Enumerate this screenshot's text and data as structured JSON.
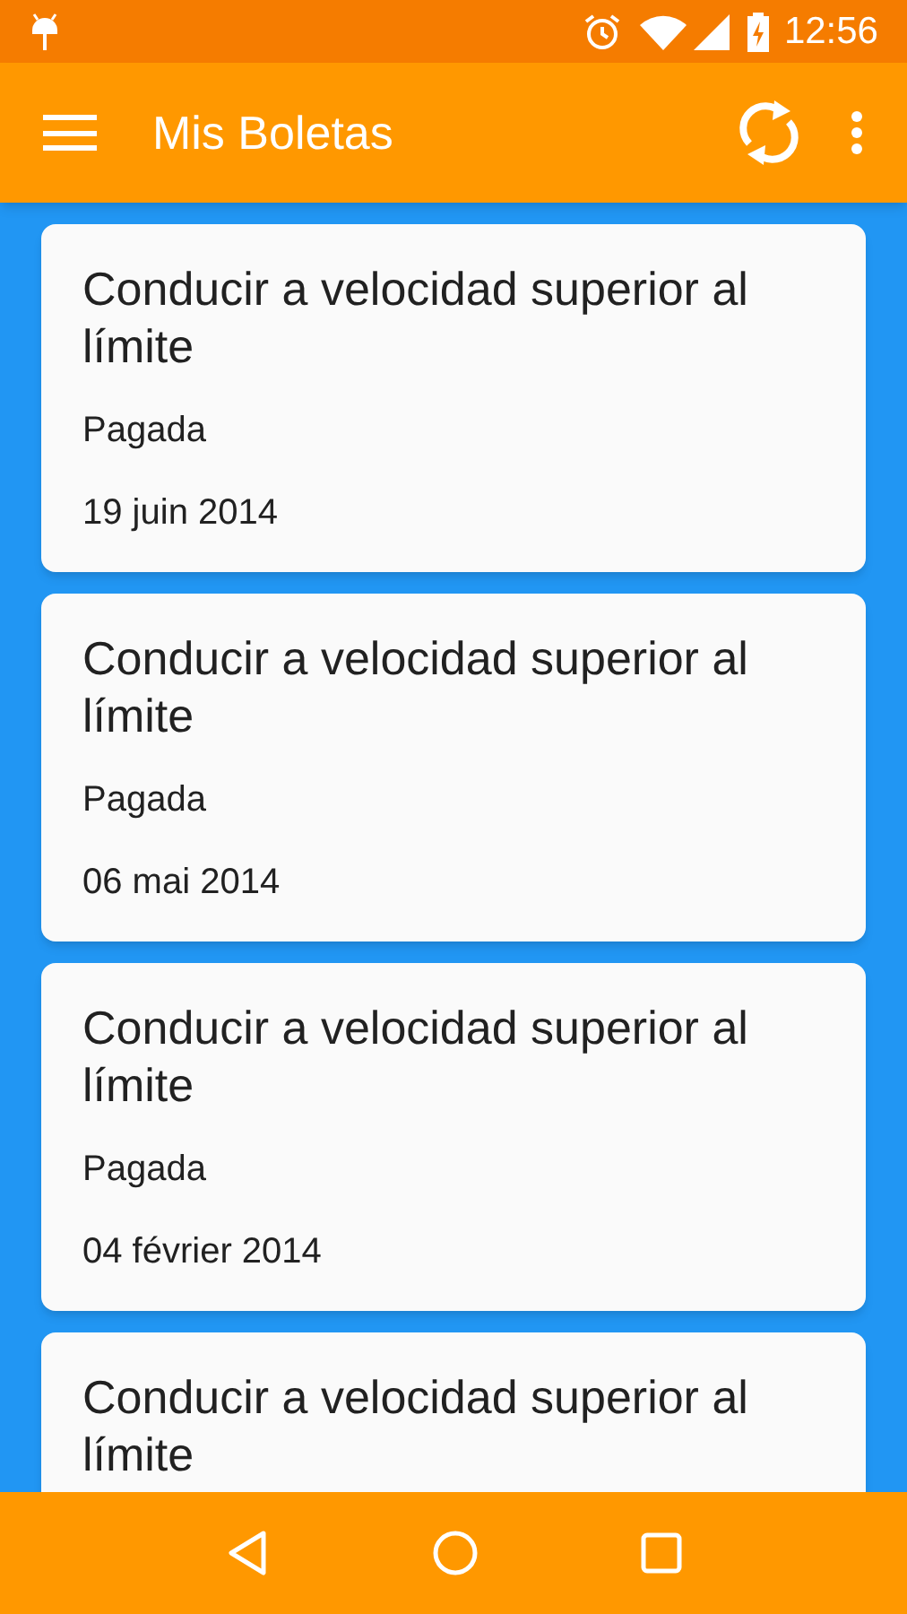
{
  "status_bar": {
    "time": "12:56"
  },
  "app_bar": {
    "title": "Mis Boletas"
  },
  "tickets": [
    {
      "title": "Conducir a velocidad superior al límite",
      "status": "Pagada",
      "date": "19 juin 2014"
    },
    {
      "title": "Conducir a velocidad superior al límite",
      "status": "Pagada",
      "date": "06 mai 2014"
    },
    {
      "title": "Conducir a velocidad superior al límite",
      "status": "Pagada",
      "date": "04 février 2014"
    },
    {
      "title": "Conducir a velocidad superior al límite"
    }
  ]
}
